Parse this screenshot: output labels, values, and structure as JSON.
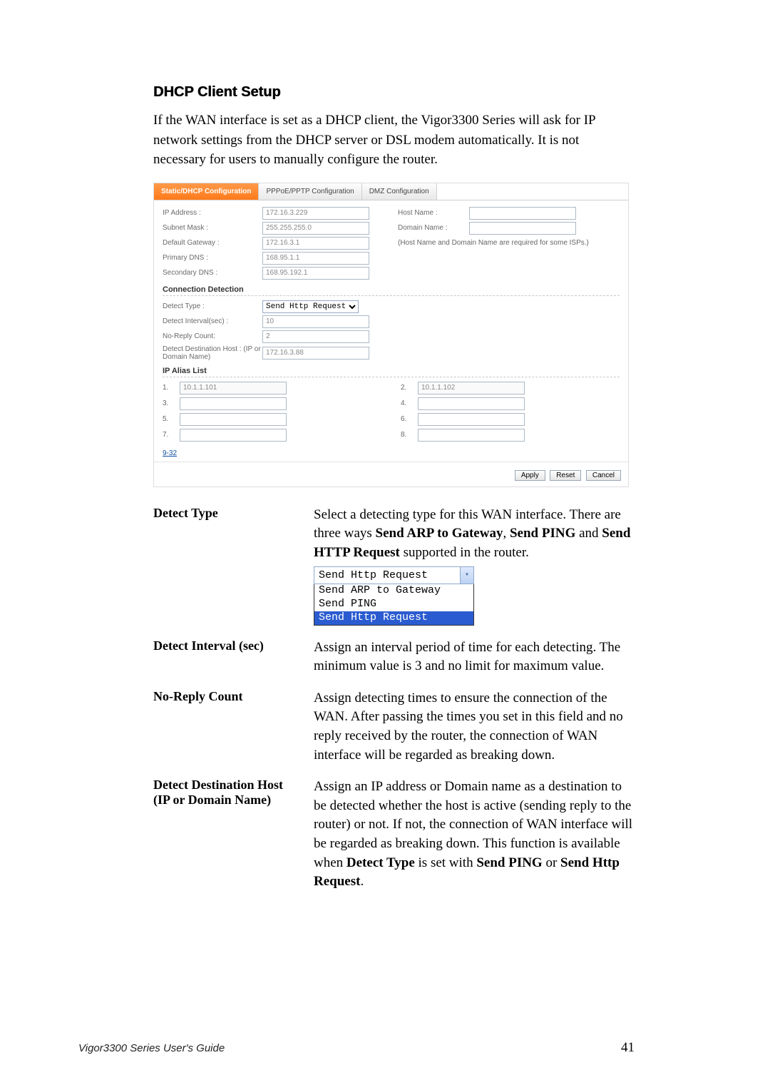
{
  "heading": "DHCP Client Setup",
  "intro": "If the WAN interface is set as a DHCP client, the Vigor3300 Series will ask for IP network settings from the DHCP server or DSL modem automatically. It is not necessary for users to manually configure the router.",
  "tabs": {
    "active": "Static/DHCP Configuration",
    "t2": "PPPoE/PPTP Configuration",
    "t3": "DMZ Configuration"
  },
  "form": {
    "ip_label": "IP Address :",
    "ip_value": "172.16.3.229",
    "mask_label": "Subnet Mask :",
    "mask_value": "255.255.255.0",
    "gw_label": "Default Gateway :",
    "gw_value": "172.16.3.1",
    "pdns_label": "Primary DNS :",
    "pdns_value": "168.95.1.1",
    "sdns_label": "Secondary DNS :",
    "sdns_value": "168.95.192.1",
    "host_label": "Host Name :",
    "domain_label": "Domain Name :",
    "isp_note": "(Host Name and Domain Name are required for some ISPs.)"
  },
  "conn": {
    "heading": "Connection Detection",
    "detect_type_label": "Detect Type :",
    "detect_type_value": "Send Http Request",
    "interval_label": "Detect Interval(sec) :",
    "interval_value": "10",
    "noreply_label": "No-Reply Count:",
    "noreply_value": "2",
    "desthost_label": "Detect Destination Host : (IP or Domain Name)",
    "desthost_value": "172.16.3.88"
  },
  "alias": {
    "heading": "IP Alias List",
    "n1": "1.",
    "v1": "10.1.1.101",
    "n2": "2.",
    "v2": "10.1.1.102",
    "n3": "3.",
    "n4": "4.",
    "n5": "5.",
    "n6": "6.",
    "n7": "7.",
    "n8": "8.",
    "more": "9-32"
  },
  "buttons": {
    "apply": "Apply",
    "reset": "Reset",
    "cancel": "Cancel"
  },
  "defs": {
    "detect_type": {
      "term": "Detect Type",
      "desc_pre": "Select a detecting type for this WAN interface. There are three ways ",
      "b1": "Send ARP to Gateway",
      "sep1": ", ",
      "b2": "Send PING",
      "sep2": " and ",
      "b3": "Send HTTP Request",
      "desc_post": " supported in the router.",
      "dd_selected": "Send Http Request",
      "dd_opt1": "Send ARP to Gateway",
      "dd_opt2": "Send PING",
      "dd_opt3": "Send Http Request"
    },
    "interval": {
      "term": "Detect Interval (sec)",
      "desc": "Assign an interval period of time for each detecting. The minimum value is 3 and no limit for maximum value."
    },
    "noreply": {
      "term": "No-Reply Count",
      "desc": "Assign detecting times to ensure the connection of the WAN. After passing the times you set in this field and no reply received by the router, the connection of WAN interface will be regarded as breaking down."
    },
    "desthost": {
      "term1": "Detect Destination Host",
      "term2": "(IP or Domain Name)",
      "p1": "Assign an IP address or Domain name as a destination to be detected whether the host is active (sending reply to the router) or not. If not, the connection of WAN interface will be regarded as breaking down. This function is available when ",
      "b1": "Detect Type",
      "mid1": " is set with ",
      "b2": "Send PING",
      "mid2": " or ",
      "b3": "Send Http Request",
      "end": "."
    }
  },
  "footer": {
    "title": "Vigor3300 Series User's Guide",
    "page": "41"
  }
}
